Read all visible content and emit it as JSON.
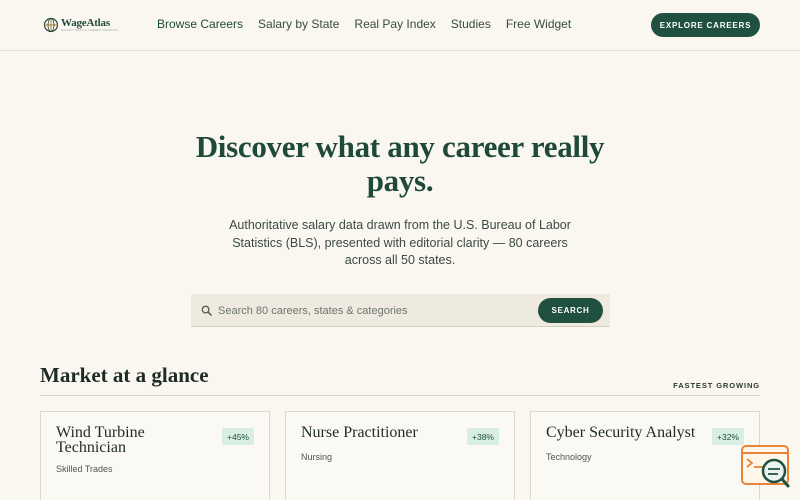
{
  "brand": {
    "name": "WageAtlas",
    "tagline": "SALARY DATA & CAREER INSIGHTS"
  },
  "nav": {
    "items": [
      {
        "label": "Browse Careers"
      },
      {
        "label": "Salary by State"
      },
      {
        "label": "Real Pay Index"
      },
      {
        "label": "Studies"
      },
      {
        "label": "Free Widget"
      }
    ],
    "cta_label": "EXPLORE CAREERS"
  },
  "hero": {
    "title": "Discover what any career really pays.",
    "subtitle": "Authoritative salary data drawn from the U.S. Bureau of Labor Statistics (BLS), presented with editorial clarity — 80 careers across all 50 states."
  },
  "search": {
    "placeholder": "Search 80 careers, states & categories",
    "button_label": "SEARCH"
  },
  "market": {
    "title": "Market at a glance",
    "tag": "FASTEST GROWING",
    "cards": [
      {
        "title": "Wind Turbine Technician",
        "badge": "+45%",
        "category": "Skilled Trades"
      },
      {
        "title": "Nurse Practitioner",
        "badge": "+38%",
        "category": "Nursing"
      },
      {
        "title": "Cyber Security Analyst",
        "badge": "+32%",
        "category": "Technology"
      }
    ]
  },
  "colors": {
    "primary": "#1f5040",
    "heading": "#1f4a3a",
    "background": "#faf7f1",
    "badge_bg": "#d8eee0",
    "widget_orange": "#e8833a"
  },
  "icons": {
    "logo": "compass-globe-icon",
    "search": "search-icon",
    "help": "chat-search-icon"
  }
}
